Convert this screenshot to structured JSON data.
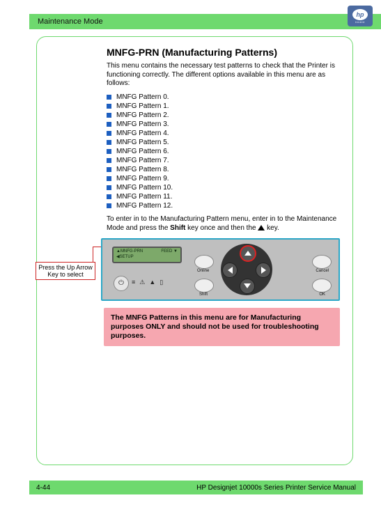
{
  "header": {
    "title": "Maintenance Mode",
    "logo_text": "hp",
    "logo_sub": "invent"
  },
  "section": {
    "title": "MNFG-PRN (Manufacturing Patterns)",
    "intro": "This menu contains the necessary test patterns to check that the Printer is functioning correctly. The different options available in this menu are as follows:",
    "patterns": [
      "MNFG Pattern 0.",
      "MNFG Pattern 1.",
      "MNFG Pattern 2.",
      "MNFG Pattern 3.",
      "MNFG Pattern 4.",
      "MNFG Pattern 5.",
      "MNFG Pattern 6.",
      "MNFG Pattern 7.",
      "MNFG Pattern 8.",
      "MNFG Pattern 9.",
      "MNFG Pattern 10.",
      "MNFG Pattern 11.",
      "MNFG Pattern 12."
    ],
    "instruction_pre": "To enter in to the Manufacturing Pattern menu, enter in to the Maintenance Mode and press the ",
    "instruction_bold": "Shift",
    "instruction_mid": " key once and then the ",
    "instruction_post": " key."
  },
  "panel": {
    "lcd_line1_left": "▲MNFG-PRN",
    "lcd_line1_right": "FEED ▼",
    "lcd_line2_left": "◀SETUP",
    "callout": "Press the Up Arrow Key to select",
    "labels": {
      "online": "Online",
      "cancel": "Cancel",
      "shift": "Shift",
      "ok": "OK"
    },
    "icons": {
      "power": "⏻",
      "lines": "≡",
      "warn": "⚠",
      "drop": "▲",
      "ink": "▯"
    }
  },
  "warning": "The MNFG Patterns in this menu are for Manufacturing purposes ONLY and should not be used for troubleshooting purposes.",
  "footer": {
    "page": "4-44",
    "manual": "HP Designjet 10000s Series Printer Service Manual"
  }
}
